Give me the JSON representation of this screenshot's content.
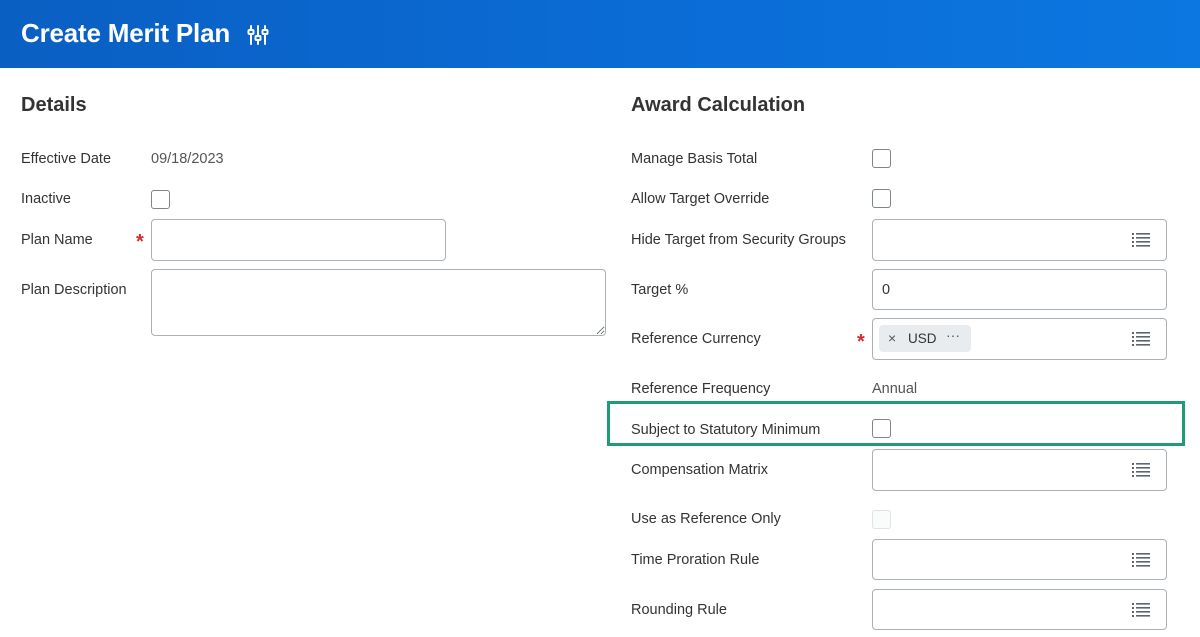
{
  "header": {
    "title": "Create Merit Plan",
    "settings_icon": "sliders-icon"
  },
  "details": {
    "title": "Details",
    "effective_date": {
      "label": "Effective Date",
      "value": "09/18/2023"
    },
    "inactive": {
      "label": "Inactive",
      "checked": false
    },
    "plan_name": {
      "label": "Plan Name",
      "required_mark": "*",
      "value": ""
    },
    "plan_description": {
      "label": "Plan Description",
      "value": ""
    }
  },
  "award": {
    "title": "Award Calculation",
    "manage_basis_total": {
      "label": "Manage Basis Total",
      "checked": false
    },
    "allow_target_override": {
      "label": "Allow Target Override",
      "checked": false
    },
    "hide_target": {
      "label": "Hide Target from Security Groups"
    },
    "target_pct": {
      "label": "Target %",
      "value": "0"
    },
    "reference_currency": {
      "label": "Reference Currency",
      "required_mark": "*",
      "selected": {
        "remove_icon": "×",
        "text": "USD",
        "more_icon": "···"
      }
    },
    "reference_frequency": {
      "label": "Reference Frequency",
      "value": "Annual"
    },
    "statutory_minimum": {
      "label": "Subject to Statutory Minimum",
      "checked": false
    },
    "compensation_matrix": {
      "label": "Compensation Matrix"
    },
    "use_as_reference": {
      "label": "Use as Reference Only",
      "checked": false,
      "disabled": true
    },
    "time_proration_rule": {
      "label": "Time Proration Rule"
    },
    "rounding_rule": {
      "label": "Rounding Rule"
    }
  },
  "colors": {
    "header": "#0b6cd6",
    "required": "#d12d2d",
    "highlight": "#1f9b78"
  }
}
